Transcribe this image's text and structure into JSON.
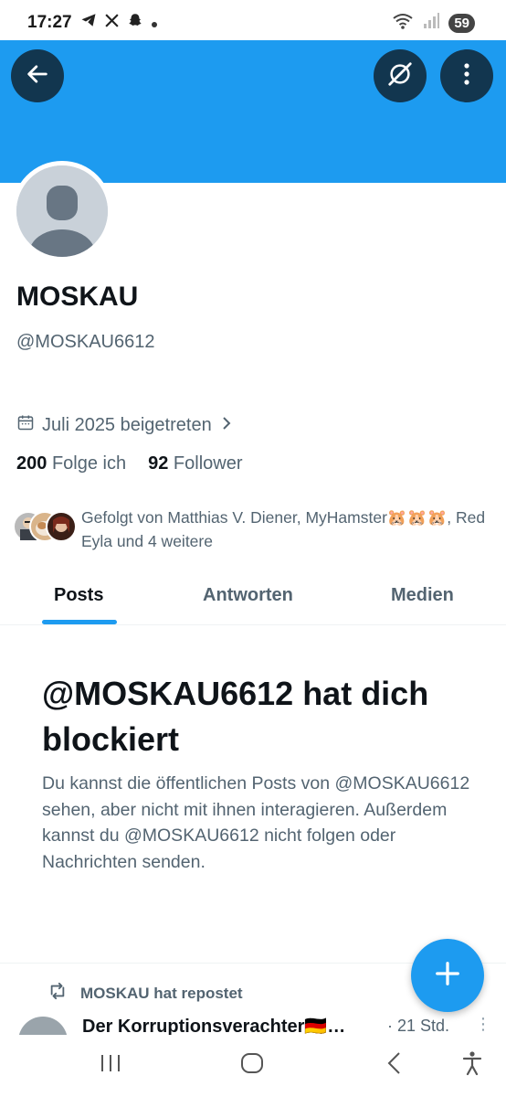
{
  "status_bar": {
    "time": "17:27",
    "battery": "59"
  },
  "profile": {
    "display_name": "MOSKAU",
    "handle": "@MOSKAU6612",
    "joined": "Juli 2025 beigetreten",
    "following_count": "200",
    "following_label": "Folge ich",
    "followers_count": "92",
    "followers_label": "Follower",
    "followed_by": "Gefolgt von Matthias V. Diener, MyHamster🐹🐹🐹, Red Eyla und 4 weitere"
  },
  "tabs": [
    {
      "label": "Posts",
      "active": true
    },
    {
      "label": "Antworten",
      "active": false
    },
    {
      "label": "Medien",
      "active": false
    }
  ],
  "blocked": {
    "title": "@MOSKAU6612 hat dich blockiert",
    "body": "Du kannst die öffentlichen Posts von @MOSKAU6612 sehen, aber nicht mit ihnen interagieren. Außerdem kannst du @MOSKAU6612 nicht folgen oder Nachrichten senden."
  },
  "feed": {
    "repost_label": "MOSKAU hat repostet",
    "tweet_author": "Der Korruptionsverachter🇩🇪…",
    "tweet_time": "· 21 Std."
  },
  "colors": {
    "accent": "#1d9bf0",
    "text_primary": "#0f1419",
    "text_secondary": "#536471"
  },
  "icons": {
    "back": "arrow-left-icon",
    "grok": "grok-icon",
    "more": "more-vertical-icon",
    "calendar": "calendar-icon",
    "repost": "repost-icon",
    "compose": "plus-icon"
  }
}
